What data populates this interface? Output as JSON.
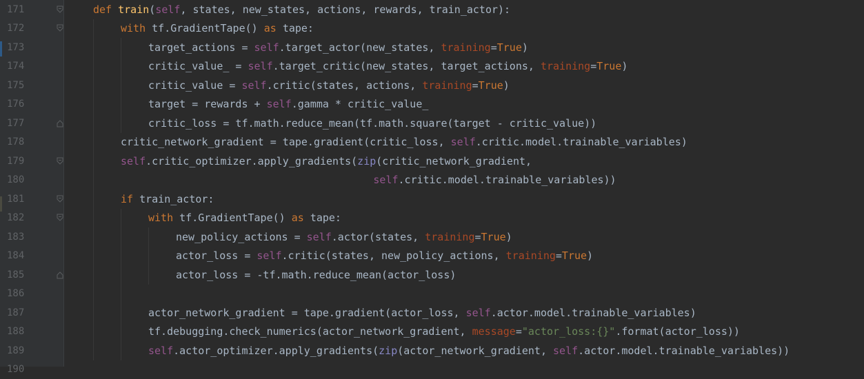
{
  "editor": {
    "language": "python",
    "colors": {
      "background": "#2b2b2b",
      "gutter": "#313335",
      "line_number": "#606366",
      "keyword": "#cc7832",
      "function": "#ffc66d",
      "self": "#94558d",
      "keyword_argument": "#aa4926",
      "string": "#6a8759",
      "builtin": "#8888c6",
      "default_text": "#a9b7c6"
    },
    "lines": [
      {
        "number": "171",
        "indent": 0,
        "fold": "open",
        "tokens": [
          [
            "kw",
            "def "
          ],
          [
            "fn",
            "train"
          ],
          [
            "t",
            "("
          ],
          [
            "self",
            "self"
          ],
          [
            "t",
            ", states, new_states, actions, rewards, train_actor):"
          ]
        ]
      },
      {
        "number": "172",
        "indent": 1,
        "fold": "open",
        "tokens": [
          [
            "kw",
            "with "
          ],
          [
            "t",
            "tf.GradientTape() "
          ],
          [
            "kw",
            "as "
          ],
          [
            "t",
            "tape:"
          ]
        ]
      },
      {
        "number": "173",
        "indent": 2,
        "fold": "",
        "tokens": [
          [
            "t",
            "target_actions = "
          ],
          [
            "self",
            "self"
          ],
          [
            "t",
            ".target_actor(new_states, "
          ],
          [
            "kwarg",
            "training"
          ],
          [
            "t",
            "="
          ],
          [
            "kw",
            "True"
          ],
          [
            "t",
            ")"
          ]
        ]
      },
      {
        "number": "174",
        "indent": 2,
        "fold": "",
        "tokens": [
          [
            "t",
            "critic_value_ = "
          ],
          [
            "self",
            "self"
          ],
          [
            "t",
            ".target_critic(new_states, target_actions, "
          ],
          [
            "kwarg",
            "training"
          ],
          [
            "t",
            "="
          ],
          [
            "kw",
            "True"
          ],
          [
            "t",
            ")"
          ]
        ]
      },
      {
        "number": "175",
        "indent": 2,
        "fold": "",
        "tokens": [
          [
            "t",
            "critic_value = "
          ],
          [
            "self",
            "self"
          ],
          [
            "t",
            ".critic(states, actions, "
          ],
          [
            "kwarg",
            "training"
          ],
          [
            "t",
            "="
          ],
          [
            "kw",
            "True"
          ],
          [
            "t",
            ")"
          ]
        ]
      },
      {
        "number": "176",
        "indent": 2,
        "fold": "",
        "tokens": [
          [
            "t",
            "target = rewards + "
          ],
          [
            "self",
            "self"
          ],
          [
            "t",
            ".gamma * critic_value_"
          ]
        ]
      },
      {
        "number": "177",
        "indent": 2,
        "fold": "close",
        "tokens": [
          [
            "t",
            "critic_loss = tf.math.reduce_mean(tf.math.square(target - critic_value))"
          ]
        ]
      },
      {
        "number": "178",
        "indent": 1,
        "fold": "",
        "tokens": [
          [
            "t",
            "critic_network_gradient = tape.gradient(critic_loss, "
          ],
          [
            "self",
            "self"
          ],
          [
            "t",
            ".critic.model.trainable_variables)"
          ]
        ]
      },
      {
        "number": "179",
        "indent": 1,
        "fold": "open",
        "tokens": [
          [
            "self",
            "self"
          ],
          [
            "t",
            ".critic_optimizer.apply_gradients("
          ],
          [
            "builtin",
            "zip"
          ],
          [
            "t",
            "(critic_network_gradient,"
          ]
        ]
      },
      {
        "number": "180",
        "indent": 0,
        "fold": "",
        "pad": "                                             ",
        "tokens": [
          [
            "self",
            "self"
          ],
          [
            "t",
            ".critic.model.trainable_variables))"
          ]
        ]
      },
      {
        "number": "181",
        "indent": 1,
        "fold": "open",
        "tokens": [
          [
            "kw",
            "if "
          ],
          [
            "t",
            "train_actor:"
          ]
        ]
      },
      {
        "number": "182",
        "indent": 2,
        "fold": "open",
        "tokens": [
          [
            "kw",
            "with "
          ],
          [
            "t",
            "tf.GradientTape() "
          ],
          [
            "kw",
            "as "
          ],
          [
            "t",
            "tape:"
          ]
        ]
      },
      {
        "number": "183",
        "indent": 3,
        "fold": "",
        "tokens": [
          [
            "t",
            "new_policy_actions = "
          ],
          [
            "self",
            "self"
          ],
          [
            "t",
            ".actor(states, "
          ],
          [
            "kwarg",
            "training"
          ],
          [
            "t",
            "="
          ],
          [
            "kw",
            "True"
          ],
          [
            "t",
            ")"
          ]
        ]
      },
      {
        "number": "184",
        "indent": 3,
        "fold": "",
        "tokens": [
          [
            "t",
            "actor_loss = "
          ],
          [
            "self",
            "self"
          ],
          [
            "t",
            ".critic(states, new_policy_actions, "
          ],
          [
            "kwarg",
            "training"
          ],
          [
            "t",
            "="
          ],
          [
            "kw",
            "True"
          ],
          [
            "t",
            ")"
          ]
        ]
      },
      {
        "number": "185",
        "indent": 3,
        "fold": "close",
        "tokens": [
          [
            "t",
            "actor_loss = -tf.math.reduce_mean(actor_loss)"
          ]
        ]
      },
      {
        "number": "186",
        "indent": 0,
        "fold": "",
        "tokens": []
      },
      {
        "number": "187",
        "indent": 2,
        "fold": "",
        "tokens": [
          [
            "t",
            "actor_network_gradient = tape.gradient(actor_loss, "
          ],
          [
            "self",
            "self"
          ],
          [
            "t",
            ".actor.model.trainable_variables)"
          ]
        ]
      },
      {
        "number": "188",
        "indent": 2,
        "fold": "",
        "tokens": [
          [
            "t",
            "tf.debugging.check_numerics(actor_network_gradient, "
          ],
          [
            "kwarg",
            "message"
          ],
          [
            "t",
            "="
          ],
          [
            "str",
            "\"actor_loss:{}\""
          ],
          [
            "t",
            ".format(actor_loss))"
          ]
        ]
      },
      {
        "number": "189",
        "indent": 2,
        "fold": "",
        "tokens": [
          [
            "self",
            "self"
          ],
          [
            "t",
            ".actor_optimizer.apply_gradients("
          ],
          [
            "builtin",
            "zip"
          ],
          [
            "t",
            "(actor_network_gradient, "
          ],
          [
            "self",
            "self"
          ],
          [
            "t",
            ".actor.model.trainable_variables))"
          ]
        ]
      },
      {
        "number": "190",
        "indent": 0,
        "fold": "",
        "tokens": []
      }
    ]
  }
}
